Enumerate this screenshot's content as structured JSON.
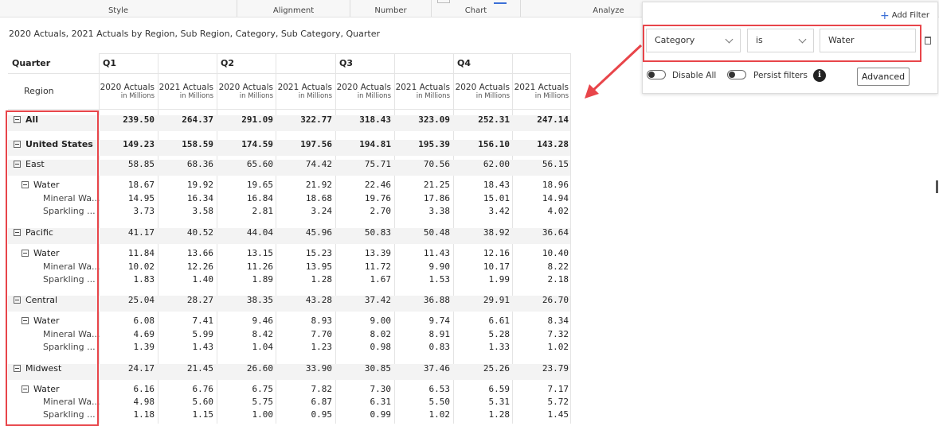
{
  "ribbon": {
    "tabs": [
      {
        "label": "Style"
      },
      {
        "label": "Alignment"
      },
      {
        "label": "Number"
      },
      {
        "label": "Chart"
      },
      {
        "label": "Analyze"
      }
    ]
  },
  "subtitle": "2020 Actuals, 2021 Actuals by Region, Sub Region, Category, Sub Category, Quarter",
  "table": {
    "quarter_label": "Quarter",
    "region_label": "Region",
    "quarters": [
      "Q1",
      "Q2",
      "Q3",
      "Q4"
    ],
    "columns": [
      {
        "title": "2020 Actuals",
        "unit": "in Millions"
      },
      {
        "title": "2021 Actuals",
        "unit": "in Millions"
      },
      {
        "title": "2020 Actuals",
        "unit": "in Millions"
      },
      {
        "title": "2021 Actuals",
        "unit": "in Millions"
      },
      {
        "title": "2020 Actuals",
        "unit": "in Millions"
      },
      {
        "title": "2021 Actuals",
        "unit": "in Millions"
      },
      {
        "title": "2020 Actuals",
        "unit": "in Millions"
      },
      {
        "title": "2021 Actuals",
        "unit": "in Millions"
      }
    ],
    "rows": [
      {
        "label": "All",
        "level": 0,
        "bold": true,
        "collapse": true,
        "values": [
          "239.50",
          "264.37",
          "291.09",
          "322.77",
          "318.43",
          "323.09",
          "252.31",
          "247.14"
        ]
      },
      {
        "label": "United States",
        "level": 0,
        "bold": true,
        "collapse": true,
        "values": [
          "149.23",
          "158.59",
          "174.59",
          "197.56",
          "194.81",
          "195.39",
          "156.10",
          "143.28"
        ]
      },
      {
        "label": "East",
        "level": 1,
        "bold": false,
        "collapse": true,
        "values": [
          "58.85",
          "68.36",
          "65.60",
          "74.42",
          "75.71",
          "70.56",
          "62.00",
          "56.15"
        ]
      },
      {
        "label": "Water",
        "level": 2,
        "bold": false,
        "collapse": true,
        "values": [
          "18.67",
          "19.92",
          "19.65",
          "21.92",
          "22.46",
          "21.25",
          "18.43",
          "18.96"
        ]
      },
      {
        "label": "Mineral Wa...",
        "level": 3,
        "bold": false,
        "collapse": false,
        "values": [
          "14.95",
          "16.34",
          "16.84",
          "18.68",
          "19.76",
          "17.86",
          "15.01",
          "14.94"
        ]
      },
      {
        "label": "Sparkling ...",
        "level": 3,
        "bold": false,
        "collapse": false,
        "values": [
          "3.73",
          "3.58",
          "2.81",
          "3.24",
          "2.70",
          "3.38",
          "3.42",
          "4.02"
        ]
      },
      {
        "label": "Pacific",
        "level": 1,
        "bold": false,
        "collapse": true,
        "values": [
          "41.17",
          "40.52",
          "44.04",
          "45.96",
          "50.83",
          "50.48",
          "38.92",
          "36.64"
        ]
      },
      {
        "label": "Water",
        "level": 2,
        "bold": false,
        "collapse": true,
        "values": [
          "11.84",
          "13.66",
          "13.15",
          "15.23",
          "13.39",
          "11.43",
          "12.16",
          "10.40"
        ]
      },
      {
        "label": "Mineral Wa...",
        "level": 3,
        "bold": false,
        "collapse": false,
        "values": [
          "10.02",
          "12.26",
          "11.26",
          "13.95",
          "11.72",
          "9.90",
          "10.17",
          "8.22"
        ]
      },
      {
        "label": "Sparkling ...",
        "level": 3,
        "bold": false,
        "collapse": false,
        "values": [
          "1.83",
          "1.40",
          "1.89",
          "1.28",
          "1.67",
          "1.53",
          "1.99",
          "2.18"
        ]
      },
      {
        "label": "Central",
        "level": 1,
        "bold": false,
        "collapse": true,
        "values": [
          "25.04",
          "28.27",
          "38.35",
          "43.28",
          "37.42",
          "36.88",
          "29.91",
          "26.70"
        ]
      },
      {
        "label": "Water",
        "level": 2,
        "bold": false,
        "collapse": true,
        "values": [
          "6.08",
          "7.41",
          "9.46",
          "8.93",
          "9.00",
          "9.74",
          "6.61",
          "8.34"
        ]
      },
      {
        "label": "Mineral Wa...",
        "level": 3,
        "bold": false,
        "collapse": false,
        "values": [
          "4.69",
          "5.99",
          "8.42",
          "7.70",
          "8.02",
          "8.91",
          "5.28",
          "7.32"
        ]
      },
      {
        "label": "Sparkling ...",
        "level": 3,
        "bold": false,
        "collapse": false,
        "values": [
          "1.39",
          "1.43",
          "1.04",
          "1.23",
          "0.98",
          "0.83",
          "1.33",
          "1.02"
        ]
      },
      {
        "label": "Midwest",
        "level": 1,
        "bold": false,
        "collapse": true,
        "values": [
          "24.17",
          "21.45",
          "26.60",
          "33.90",
          "30.85",
          "37.46",
          "25.26",
          "23.79"
        ]
      },
      {
        "label": "Water",
        "level": 2,
        "bold": false,
        "collapse": true,
        "values": [
          "6.16",
          "6.76",
          "6.75",
          "7.82",
          "7.30",
          "6.53",
          "6.59",
          "7.17"
        ]
      },
      {
        "label": "Mineral Wa...",
        "level": 3,
        "bold": false,
        "collapse": false,
        "values": [
          "4.98",
          "5.60",
          "5.75",
          "6.87",
          "6.31",
          "5.50",
          "5.31",
          "5.72"
        ]
      },
      {
        "label": "Sparkling ...",
        "level": 3,
        "bold": false,
        "collapse": false,
        "values": [
          "1.18",
          "1.15",
          "1.00",
          "0.95",
          "0.99",
          "1.02",
          "1.28",
          "1.45"
        ]
      }
    ]
  },
  "filter_panel": {
    "add_filter_label": "Add Filter",
    "field_value": "Category",
    "operator_value": "is",
    "filter_value": "Water",
    "disable_all_label": "Disable All",
    "persist_filters_label": "Persist filters",
    "info_glyph": "i",
    "advanced_label": "Advanced"
  },
  "colors": {
    "highlight_red": "#e8454a",
    "accent_blue": "#3b6fd6"
  }
}
